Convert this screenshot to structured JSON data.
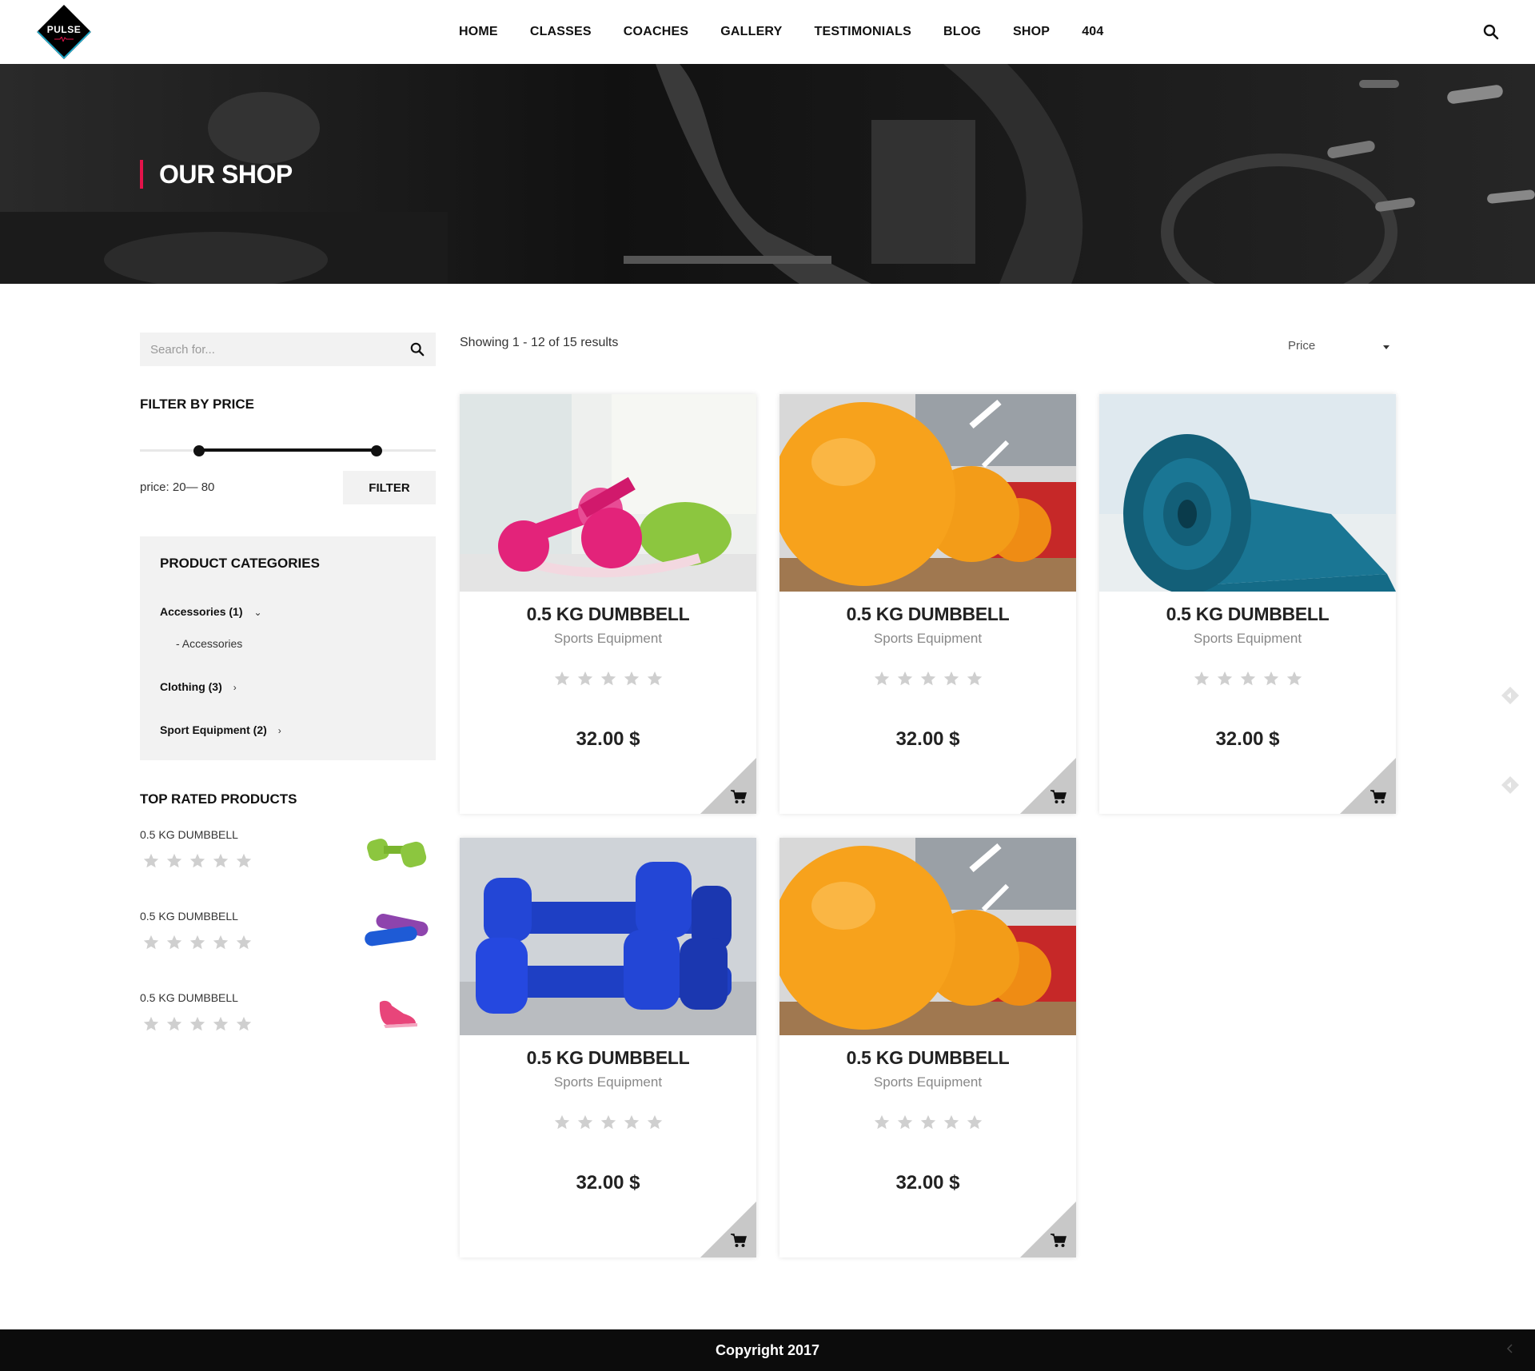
{
  "brand": {
    "logo_text": "PULSE"
  },
  "nav": {
    "items": [
      {
        "label": "HOME"
      },
      {
        "label": "CLASSES"
      },
      {
        "label": "COACHES"
      },
      {
        "label": "GALLERY"
      },
      {
        "label": "TESTIMONIALS"
      },
      {
        "label": "BLOG"
      },
      {
        "label": "SHOP"
      },
      {
        "label": "404"
      }
    ],
    "search_icon": "search-icon"
  },
  "hero": {
    "title": "OUR SHOP"
  },
  "sidebar": {
    "search": {
      "placeholder": "Search for..."
    },
    "filter": {
      "heading": "FILTER BY PRICE",
      "price_label": "price: 20— 80",
      "button": "FILTER",
      "min": 20,
      "max": 80
    },
    "categories": {
      "heading": "PRODUCT CATEGORIES",
      "items": [
        {
          "label": "Accessories (1)",
          "arrow": "chevron-down-icon",
          "sub": "- Accessories"
        },
        {
          "label": "Clothing (3)",
          "arrow": "chevron-right-icon"
        },
        {
          "label": "Sport Equipment (2)",
          "arrow": "chevron-right-icon"
        }
      ]
    },
    "top_rated": {
      "heading": "TOP RATED PRODUCTS",
      "items": [
        {
          "name": "0.5 KG DUMBBELL",
          "rating": 0,
          "image": "green-dumbbell"
        },
        {
          "name": "0.5 KG DUMBBELL",
          "rating": 0,
          "image": "yoga-mats"
        },
        {
          "name": "0.5 KG DUMBBELL",
          "rating": 0,
          "image": "pink-sneaker"
        }
      ]
    }
  },
  "shop": {
    "results_text": "Showing 1 - 12 of 15 results",
    "sort": {
      "selected": "Price"
    },
    "products": [
      {
        "title": "0.5 KG DUMBBELL",
        "category": "Sports Equipment",
        "price": "32.00 $",
        "rating": 0,
        "image": "pink-dumbbells"
      },
      {
        "title": "0.5 KG DUMBBELL",
        "category": "Sports Equipment",
        "price": "32.00 $",
        "rating": 0,
        "image": "orange-balls"
      },
      {
        "title": "0.5 KG DUMBBELL",
        "category": "Sports Equipment",
        "price": "32.00 $",
        "rating": 0,
        "image": "blue-mat"
      },
      {
        "title": "0.5 KG DUMBBELL",
        "category": "Sports Equipment",
        "price": "32.00 $",
        "rating": 0,
        "image": "blue-dumbbells"
      },
      {
        "title": "0.5 KG DUMBBELL",
        "category": "Sports Equipment",
        "price": "32.00 $",
        "rating": 0,
        "image": "orange-balls"
      }
    ]
  },
  "footer": {
    "copyright": "Copyright 2017"
  },
  "colors": {
    "accent": "#e3134a",
    "logo_edge": "#1ea7c8",
    "star": "#cfcfcf"
  }
}
